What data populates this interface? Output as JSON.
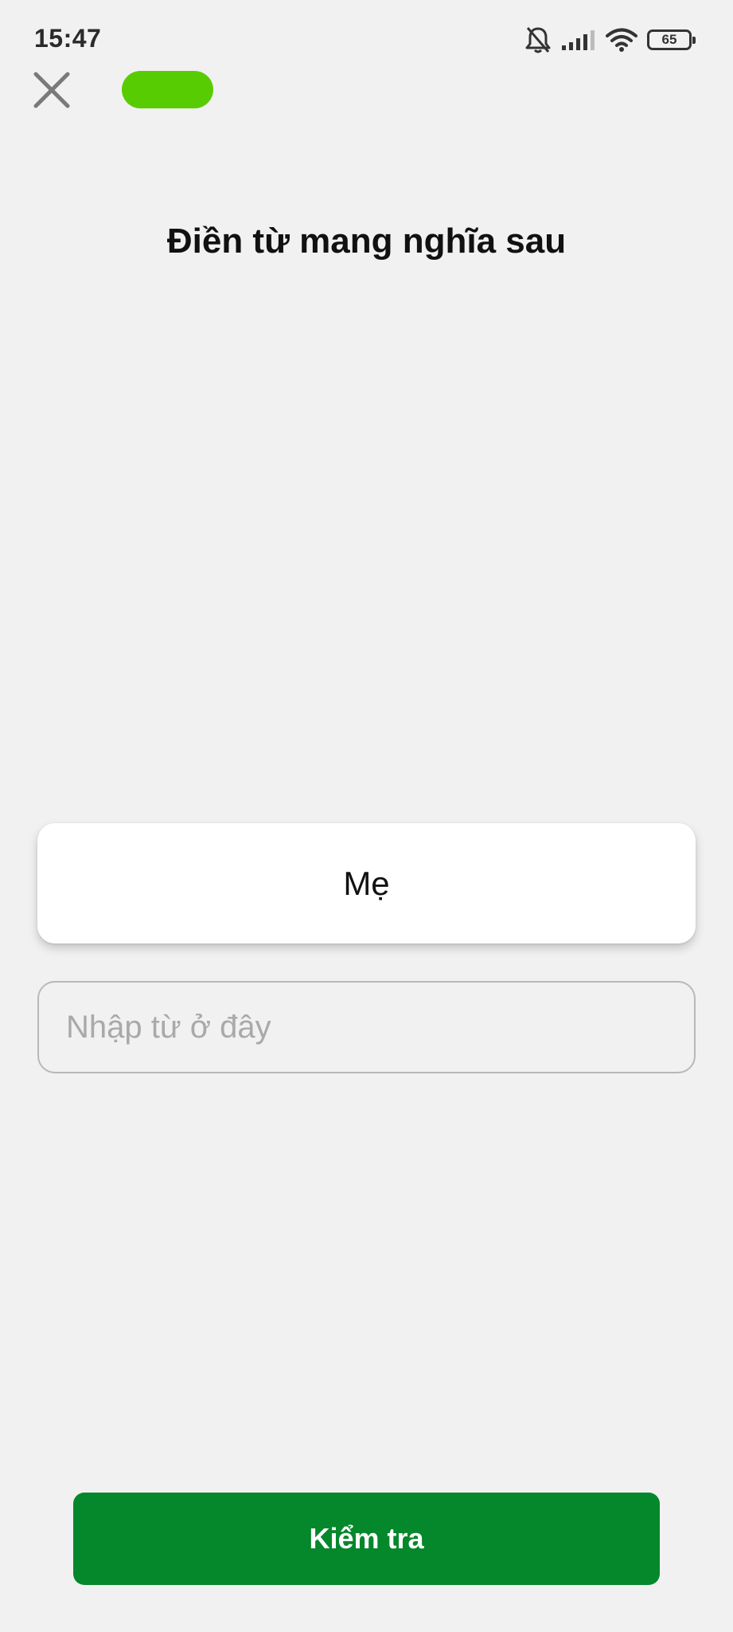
{
  "status_bar": {
    "time": "15:47",
    "battery_level": "65",
    "icons": [
      "bell-off-icon",
      "signal-icon",
      "wifi-icon",
      "battery-icon"
    ]
  },
  "header": {
    "close_icon": "close-icon",
    "progress_color": "#58cc02"
  },
  "exercise": {
    "title": "Điền từ mang nghĩa sau",
    "word": "Mẹ",
    "input_value": "",
    "input_placeholder": "Nhập từ ở đây"
  },
  "actions": {
    "check_label": "Kiểm tra",
    "check_color": "#05872b"
  }
}
